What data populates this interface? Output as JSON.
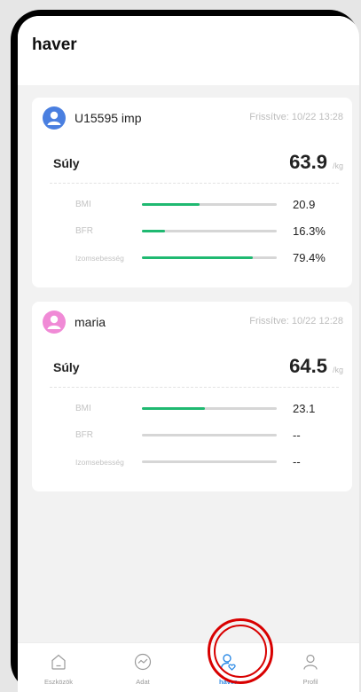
{
  "header": {
    "title": "haver"
  },
  "cards": [
    {
      "name": "U15595 imp",
      "updated": "Frissítve: 10/22 13:28",
      "avatar_color": "#4a7fe0",
      "weight_label": "Súly",
      "weight_value": "63.9",
      "weight_unit": "/kg",
      "metrics": [
        {
          "label": "BMI",
          "value": "20.9",
          "fill": 0.43
        },
        {
          "label": "BFR",
          "value": "16.3%",
          "fill": 0.17
        },
        {
          "label": "Izomsebesség",
          "value": "79.4%",
          "fill": 0.82
        }
      ]
    },
    {
      "name": "maria",
      "updated": "Frissítve: 10/22 12:28",
      "avatar_color": "#f08ad6",
      "weight_label": "Súly",
      "weight_value": "64.5",
      "weight_unit": "/kg",
      "metrics": [
        {
          "label": "BMI",
          "value": "23.1",
          "fill": 0.47
        },
        {
          "label": "BFR",
          "value": "--",
          "fill": 0
        },
        {
          "label": "Izomsebesség",
          "value": "--",
          "fill": 0
        }
      ]
    }
  ],
  "tabbar": {
    "tabs": [
      {
        "label": "Eszközök",
        "icon": "home-icon",
        "active": false
      },
      {
        "label": "Adat",
        "icon": "chart-circle-icon",
        "active": false
      },
      {
        "label": "haver",
        "icon": "friend-heart-icon",
        "active": true
      },
      {
        "label": "Profil",
        "icon": "person-icon",
        "active": false
      }
    ]
  },
  "colors": {
    "accent": "#2e8be6",
    "bar_fill": "#1fb971",
    "highlight": "#d80000"
  }
}
